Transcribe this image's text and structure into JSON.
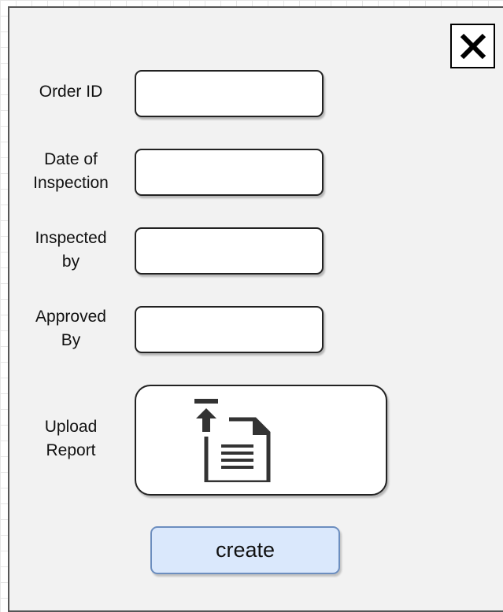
{
  "dialog": {
    "close_icon": "close-icon",
    "fields": [
      {
        "label": "Order ID",
        "value": ""
      },
      {
        "label": "Date of\nInspection",
        "value": ""
      },
      {
        "label": "Inspected\nby",
        "value": ""
      },
      {
        "label": "Approved\nBy",
        "value": ""
      }
    ],
    "upload": {
      "label": "Upload\nReport",
      "icon": "upload-file-icon"
    },
    "create_label": "create"
  }
}
